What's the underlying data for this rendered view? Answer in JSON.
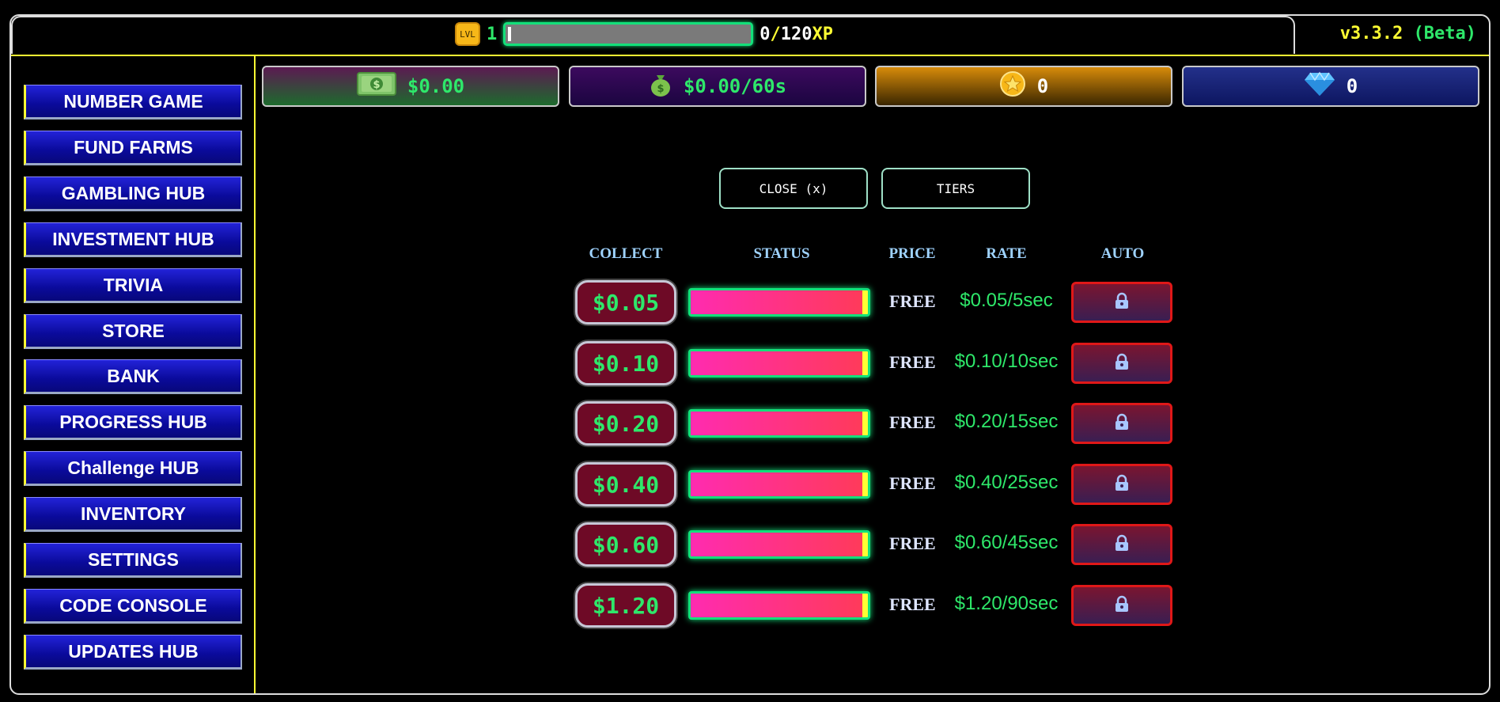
{
  "header": {
    "level_badge": "LVL",
    "level": "1",
    "xp_current": "0",
    "xp_separator": "/",
    "xp_max": "120",
    "xp_unit": "XP",
    "xp_progress": 0.0,
    "version": "v3.3.2",
    "version_tag": "(Beta)"
  },
  "sidebar": {
    "items": [
      {
        "label": "NUMBER GAME"
      },
      {
        "label": "FUND FARMS"
      },
      {
        "label": "GAMBLING HUB"
      },
      {
        "label": "INVESTMENT HUB"
      },
      {
        "label": "TRIVIA"
      },
      {
        "label": "STORE"
      },
      {
        "label": "BANK"
      },
      {
        "label": "PROGRESS HUB"
      },
      {
        "label": "Challenge HUB"
      },
      {
        "label": "INVENTORY"
      },
      {
        "label": "SETTINGS"
      },
      {
        "label": "CODE CONSOLE"
      },
      {
        "label": "UPDATES HUB"
      }
    ]
  },
  "stats": {
    "cash": "$0.00",
    "income_rate": "$0.00/60s",
    "coins": "0",
    "gems": "0"
  },
  "controls": {
    "close_label": "CLOSE (x)",
    "tiers_label": "TIERS"
  },
  "table": {
    "headers": {
      "collect": "COLLECT",
      "status": "STATUS",
      "price": "PRICE",
      "rate": "RATE",
      "auto": "AUTO"
    },
    "rows": [
      {
        "collect": "$0.05",
        "status_fill": 0.97,
        "price": "FREE",
        "rate": "$0.05/5sec",
        "auto_icon": "lock-icon"
      },
      {
        "collect": "$0.10",
        "status_fill": 0.97,
        "price": "FREE",
        "rate": "$0.10/10sec",
        "auto_icon": "lock-icon"
      },
      {
        "collect": "$0.20",
        "status_fill": 0.97,
        "price": "FREE",
        "rate": "$0.20/15sec",
        "auto_icon": "lock-icon"
      },
      {
        "collect": "$0.40",
        "status_fill": 0.97,
        "price": "FREE",
        "rate": "$0.40/25sec",
        "auto_icon": "lock-icon"
      },
      {
        "collect": "$0.60",
        "status_fill": 0.97,
        "price": "FREE",
        "rate": "$0.60/45sec",
        "auto_icon": "lock-icon"
      },
      {
        "collect": "$1.20",
        "status_fill": 0.97,
        "price": "FREE",
        "rate": "$1.20/90sec",
        "auto_icon": "lock-icon"
      }
    ]
  },
  "colors": {
    "accent_green": "#2ee86a",
    "accent_yellow": "#ffff33",
    "nav_blue": "#0a0a9a",
    "lock_red": "#e01818"
  }
}
